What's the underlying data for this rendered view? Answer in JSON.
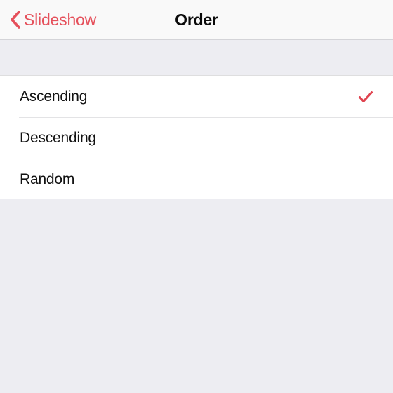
{
  "navbar": {
    "back_label": "Slideshow",
    "back_icon": "chevron-left-icon",
    "title": "Order",
    "tint_color": "#e5505b",
    "background_color": "#f9f9f9"
  },
  "list": {
    "check_icon": "checkmark-icon",
    "check_color": "#e0434f",
    "rows": [
      {
        "label": "Ascending",
        "selected": true
      },
      {
        "label": "Descending",
        "selected": false
      },
      {
        "label": "Random",
        "selected": false
      }
    ]
  },
  "page": {
    "background_color": "#ededf2"
  }
}
